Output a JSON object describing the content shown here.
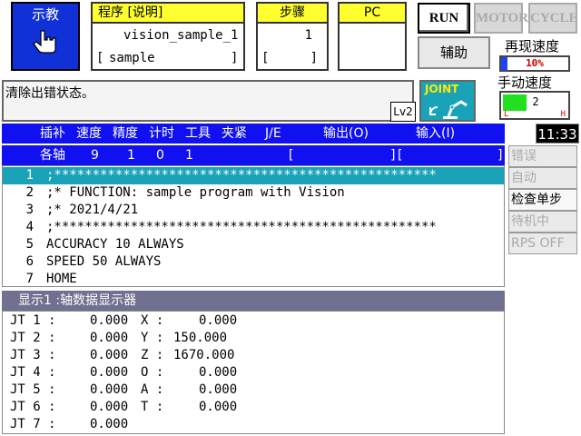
{
  "teach": {
    "label": "示教"
  },
  "program": {
    "header": "程序 [说明]",
    "name": "vision_sample_1",
    "comment_open": "[",
    "comment": "sample",
    "comment_close": "]"
  },
  "step": {
    "header": "步骤",
    "value": "1",
    "bracket_open": "[",
    "bracket_close": "]"
  },
  "pc": {
    "header": "PC"
  },
  "mode_buttons": {
    "run": "RUN",
    "motor": "MOTOR",
    "cycle": "CYCLE"
  },
  "aux": {
    "label": "辅助"
  },
  "replay_speed": {
    "label": "再现速度",
    "value": "10%",
    "percent": 10
  },
  "message": {
    "text": "清除出错状态。"
  },
  "level": {
    "text": "Lv2"
  },
  "coord_mode": {
    "label": "JOINT"
  },
  "manual_speed": {
    "label": "手动速度",
    "value": "2",
    "low": "L",
    "high": "H"
  },
  "clock": {
    "time": "11:33"
  },
  "columns": {
    "interp": "插补",
    "speed": "速度",
    "accuracy": "精度",
    "timer": "计时",
    "tool": "工具",
    "clamp": "夹紧",
    "je": "J/E",
    "output": "输出(O)",
    "input": "输入(I)"
  },
  "values_row": {
    "axes": "各轴",
    "speed": "9",
    "accuracy": "1",
    "timer": "0",
    "tool": "1",
    "out_open": "[",
    "out_close": "]",
    "in_open": "[",
    "in_close": "]"
  },
  "program_lines": [
    {
      "num": "1",
      "text": ";**************************************************"
    },
    {
      "num": "2",
      "text": ";* FUNCTION: sample program with Vision"
    },
    {
      "num": "3",
      "text": ";* 2021/4/21"
    },
    {
      "num": "4",
      "text": ";**************************************************"
    },
    {
      "num": "5",
      "text": "ACCURACY 10 ALWAYS"
    },
    {
      "num": "6",
      "text": "SPEED 50 ALWAYS"
    },
    {
      "num": "7",
      "text": "HOME"
    }
  ],
  "side_menu": [
    {
      "label": "错误"
    },
    {
      "label": "自动"
    },
    {
      "label": "检查单步"
    },
    {
      "label": "待机中"
    },
    {
      "label": "RPS OFF"
    }
  ],
  "display": {
    "header": "显示1 :轴数据显示器"
  },
  "joint_values": [
    {
      "name": "JT 1 :",
      "value": "0.000"
    },
    {
      "name": "JT 2 :",
      "value": "0.000"
    },
    {
      "name": "JT 3 :",
      "value": "0.000"
    },
    {
      "name": "JT 4 :",
      "value": "0.000"
    },
    {
      "name": "JT 5 :",
      "value": "0.000"
    },
    {
      "name": "JT 6 :",
      "value": "0.000"
    },
    {
      "name": "JT 7 :",
      "value": "0.000"
    }
  ],
  "cartesian_values": [
    {
      "name": "X :",
      "value": "0.000"
    },
    {
      "name": "Y :",
      "value": "150.000"
    },
    {
      "name": "Z :",
      "value": "1670.000"
    },
    {
      "name": "O :",
      "value": "0.000"
    },
    {
      "name": "A :",
      "value": "0.000"
    },
    {
      "name": "T :",
      "value": "0.000"
    }
  ]
}
